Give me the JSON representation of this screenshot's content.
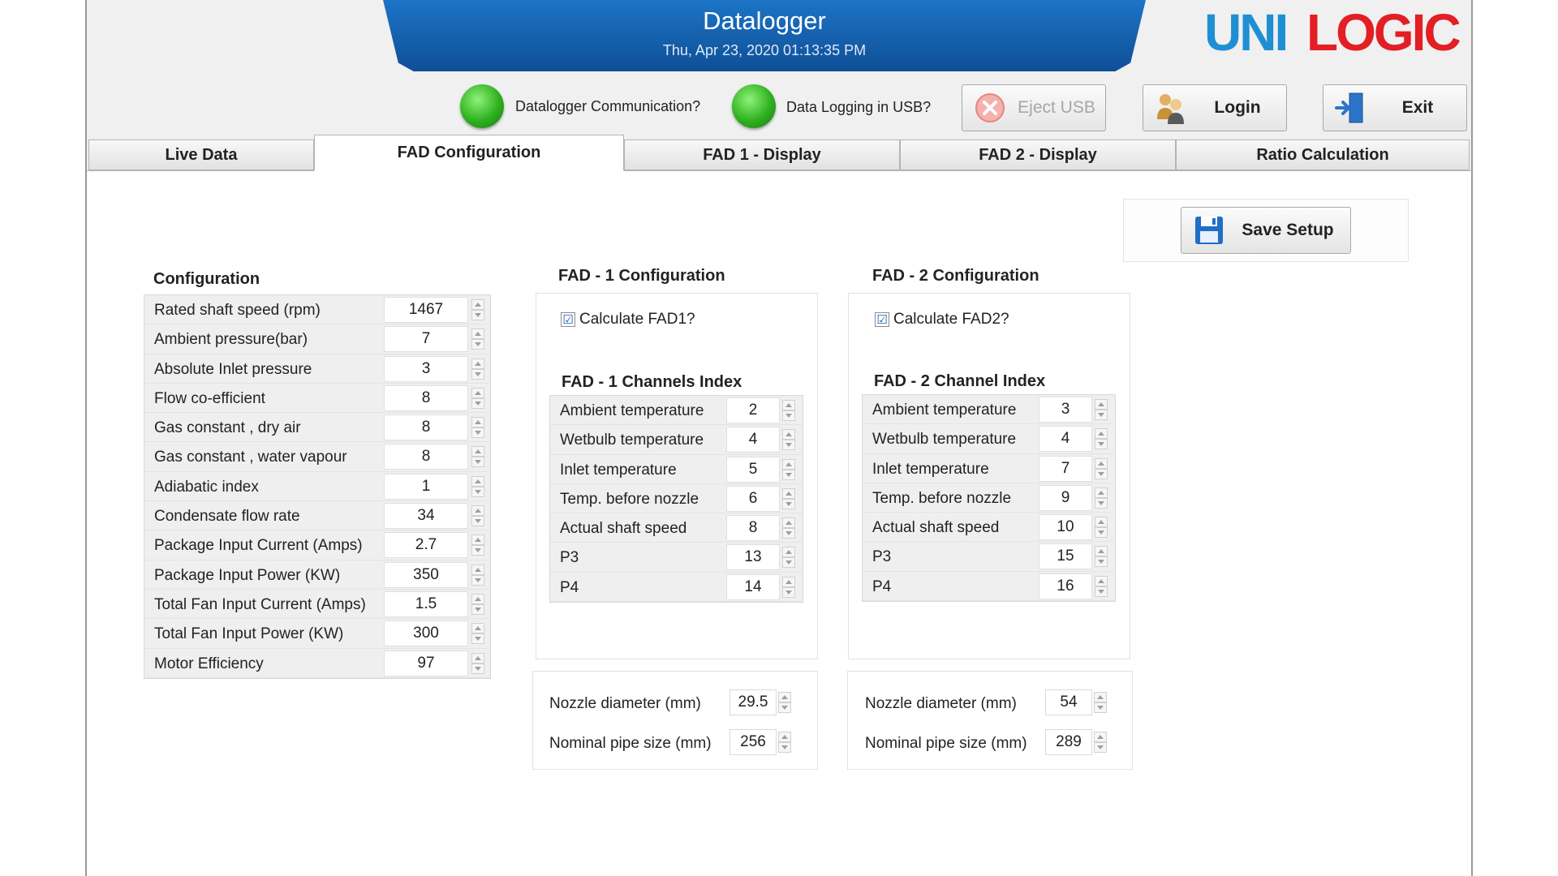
{
  "header": {
    "app_title": "Datalogger",
    "datetime": "Thu, Apr 23, 2020 01:13:35 PM",
    "logo_text": "UNILOGIC",
    "logo_colors": {
      "blue": "#1f8fd4",
      "red": "#e31e24"
    }
  },
  "status": {
    "communication_label": "Datalogger Communication?",
    "usb_logging_label": "Data Logging in USB?",
    "led_color": "#2fb11f"
  },
  "toolbar": {
    "eject_label": "Eject USB",
    "login_label": "Login",
    "exit_label": "Exit"
  },
  "tabs": [
    {
      "label": "Live Data"
    },
    {
      "label": "FAD Configuration"
    },
    {
      "label": "FAD 1 - Display"
    },
    {
      "label": "FAD 2 - Display"
    },
    {
      "label": "Ratio Calculation"
    }
  ],
  "save_label": "Save Setup",
  "configuration": {
    "title": "Configuration",
    "rows": [
      {
        "label": "Rated shaft speed (rpm)",
        "value": "1467"
      },
      {
        "label": "Ambient pressure(bar)",
        "value": "7"
      },
      {
        "label": "Absolute Inlet pressure",
        "value": "3"
      },
      {
        "label": "Flow co-efficient",
        "value": "8"
      },
      {
        "label": "Gas constant , dry air",
        "value": "8"
      },
      {
        "label": "Gas constant , water vapour",
        "value": "8"
      },
      {
        "label": "Adiabatic index",
        "value": "1"
      },
      {
        "label": "Condensate flow rate",
        "value": "34"
      },
      {
        "label": "Package Input Current (Amps)",
        "value": "2.7"
      },
      {
        "label": "Package Input Power (KW)",
        "value": "350"
      },
      {
        "label": "Total Fan Input Current (Amps)",
        "value": "1.5"
      },
      {
        "label": "Total Fan Input Power (KW)",
        "value": "300"
      },
      {
        "label": "Motor Efficiency",
        "value": "97"
      }
    ]
  },
  "fad1": {
    "title": "FAD - 1 Configuration",
    "calculate_label": "Calculate FAD1?",
    "calculate_checked": "☑",
    "channels_title": "FAD - 1 Channels Index",
    "channels": [
      {
        "label": "Ambient temperature",
        "value": "2"
      },
      {
        "label": "Wetbulb temperature",
        "value": "4"
      },
      {
        "label": "Inlet temperature",
        "value": "5"
      },
      {
        "label": "Temp. before nozzle",
        "value": "6"
      },
      {
        "label": "Actual shaft speed",
        "value": "8"
      },
      {
        "label": "P3",
        "value": "13"
      },
      {
        "label": "P4",
        "value": "14"
      }
    ],
    "nozzle_label": "Nozzle diameter (mm)",
    "nozzle_value": "29.5",
    "pipe_label": "Nominal pipe size (mm)",
    "pipe_value": "256"
  },
  "fad2": {
    "title": "FAD - 2 Configuration",
    "calculate_label": "Calculate FAD2?",
    "calculate_checked": "☑",
    "channels_title": "FAD - 2 Channel Index",
    "channels": [
      {
        "label": "Ambient temperature",
        "value": "3"
      },
      {
        "label": "Wetbulb temperature",
        "value": "4"
      },
      {
        "label": "Inlet temperature",
        "value": "7"
      },
      {
        "label": "Temp. before nozzle",
        "value": "9"
      },
      {
        "label": "Actual shaft speed",
        "value": "10"
      },
      {
        "label": "P3",
        "value": "15"
      },
      {
        "label": "P4",
        "value": "16"
      }
    ],
    "nozzle_label": "Nozzle diameter (mm)",
    "nozzle_value": "54",
    "pipe_label": "Nominal pipe size (mm)",
    "pipe_value": "289"
  },
  "icons": {
    "eject": "close-circle-icon",
    "login": "users-icon",
    "exit": "door-exit-icon",
    "save": "floppy-disk-icon"
  }
}
